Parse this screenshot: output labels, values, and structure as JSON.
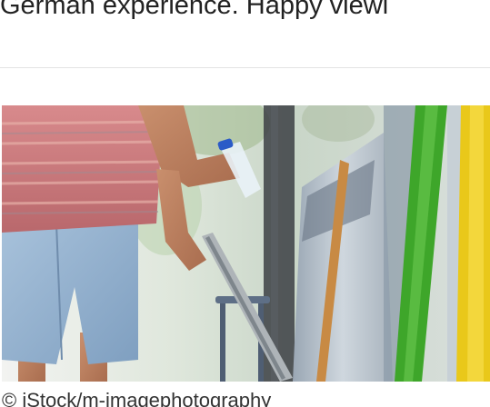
{
  "article": {
    "intro_text": "German experience. Happy viewi",
    "image": {
      "alt": "Person disposing a plastic bottle into a recycling container",
      "caption": "© iStock/m-imagephotography"
    }
  },
  "colors": {
    "text": "#222222",
    "divider": "#e3e3e3",
    "shirt": "#c97b7e",
    "shorts": "#8fb0cf",
    "bin_green": "#3ea62a",
    "bin_yellow": "#e9c81a"
  }
}
